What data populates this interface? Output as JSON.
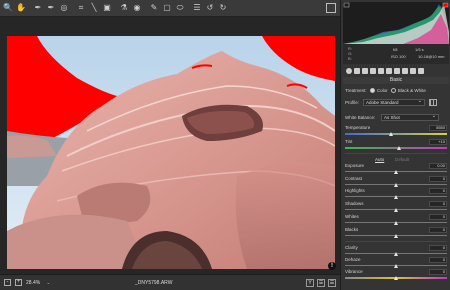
{
  "toolbar": {
    "tools": [
      "zoom-icon",
      "hand-icon",
      "white-balance-icon",
      "color-sampler-icon",
      "target-adjust-icon",
      "crop-icon",
      "straighten-icon",
      "transform-icon",
      "spot-removal-icon",
      "red-eye-icon",
      "adjustment-brush-icon",
      "graduated-filter-icon",
      "radial-filter-icon",
      "preferences-icon",
      "rotate-left-icon",
      "rotate-right-icon"
    ]
  },
  "histogram": {
    "exif_aperture": "f/8",
    "exif_shutter": "1/5 s",
    "exif_iso": "ISO 100",
    "exif_lens": "10-18@10 mm",
    "rgb_r": "R:",
    "rgb_g": "G:",
    "rgb_b": "B:"
  },
  "basic": {
    "section_title": "Basic",
    "treatment_label": "Treatment:",
    "treatment_color": "Color",
    "treatment_bw": "Black & White",
    "profile_label": "Profile:",
    "profile_value": "Adobe Standard",
    "wb_label": "White Balance:",
    "wb_value": "As Shot",
    "auto_label": "Auto",
    "default_label": "Default",
    "sliders": [
      {
        "label": "Temperature",
        "value": "5550",
        "pos": 0.45
      },
      {
        "label": "Tint",
        "value": "+10",
        "pos": 0.53
      },
      {
        "label": "Exposure",
        "value": "0.00",
        "pos": 0.5
      },
      {
        "label": "Contrast",
        "value": "0",
        "pos": 0.5
      },
      {
        "label": "Highlights",
        "value": "0",
        "pos": 0.5
      },
      {
        "label": "Shadows",
        "value": "0",
        "pos": 0.5
      },
      {
        "label": "Whites",
        "value": "0",
        "pos": 0.5
      },
      {
        "label": "Blacks",
        "value": "0",
        "pos": 0.5
      },
      {
        "label": "Clarity",
        "value": "0",
        "pos": 0.5
      },
      {
        "label": "Dehaze",
        "value": "0",
        "pos": 0.5
      },
      {
        "label": "Vibrance",
        "value": "0",
        "pos": 0.5
      }
    ]
  },
  "bottombar": {
    "zoom": "28.4%",
    "filename": "_DNY5798.ARW",
    "preview_warning": "!"
  },
  "colors": {
    "clipping": "#ff0000",
    "panel_bg": "#343434"
  }
}
